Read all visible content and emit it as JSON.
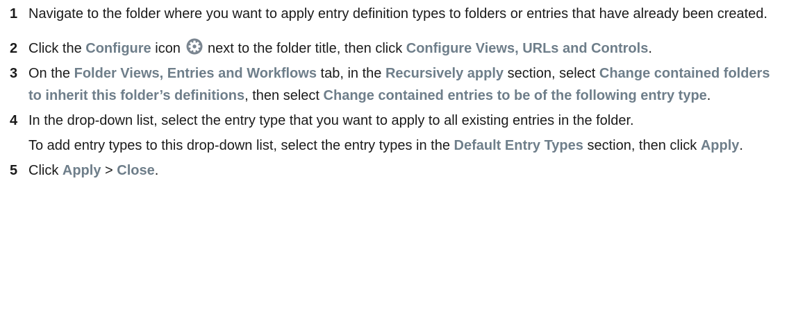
{
  "steps": [
    {
      "num": "1",
      "parts": [
        {
          "text": "Navigate to the folder where you want to apply entry definition types to folders or entries that have already been created."
        }
      ]
    },
    {
      "num": "2",
      "parts": [
        {
          "text": "Click the "
        },
        {
          "text": "Configure",
          "ui": true
        },
        {
          "text": " icon "
        },
        {
          "icon": "gear-icon"
        },
        {
          "text": " next to the folder title, then click "
        },
        {
          "text": "Configure Views, URLs and Controls",
          "ui": true
        },
        {
          "text": "."
        }
      ]
    },
    {
      "num": "3",
      "parts": [
        {
          "text": "On the "
        },
        {
          "text": "Folder Views, Entries and Workflows",
          "ui": true
        },
        {
          "text": " tab, in the "
        },
        {
          "text": "Recursively apply",
          "ui": true
        },
        {
          "text": " section, select "
        },
        {
          "text": "Change contained folders to inherit this folder’s definitions",
          "ui": true
        },
        {
          "text": ", then select "
        },
        {
          "text": "Change contained entries to be of the following entry type",
          "ui": true
        },
        {
          "text": "."
        }
      ]
    },
    {
      "num": "4",
      "parts": [
        {
          "text": "In the drop-down list, select the entry type that you want to apply to all existing entries in the folder."
        }
      ],
      "note": [
        {
          "text": "To add entry types to this drop-down list, select the entry types in the "
        },
        {
          "text": "Default Entry Types",
          "ui": true
        },
        {
          "text": " section, then click "
        },
        {
          "text": "Apply",
          "ui": true
        },
        {
          "text": "."
        }
      ]
    },
    {
      "num": "5",
      "parts": [
        {
          "text": "Click "
        },
        {
          "text": "Apply",
          "ui": true
        },
        {
          "text": " > "
        },
        {
          "text": "Close",
          "ui": true
        },
        {
          "text": "."
        }
      ]
    }
  ],
  "colors": {
    "text": "#1a1a1a",
    "ui_term": "#6e7e8a",
    "icon": "#7a8590"
  }
}
